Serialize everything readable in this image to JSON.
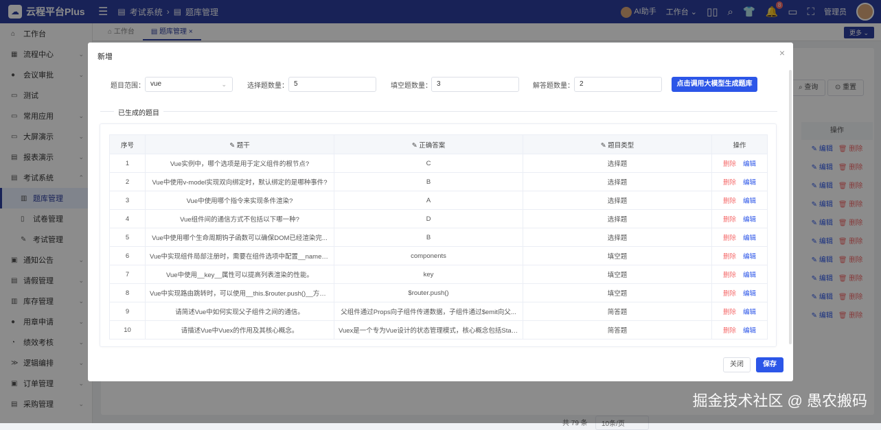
{
  "header": {
    "brand": "云程平台Plus",
    "breadcrumb": [
      "考试系统",
      "题库管理"
    ],
    "ai_label": "AI助手",
    "workbench_label": "工作台",
    "notification_count": "8",
    "user": "管理员"
  },
  "sidebar": {
    "items": [
      {
        "label": "工作台",
        "icon": "home-icon",
        "arrow": false
      },
      {
        "label": "流程中心",
        "icon": "grid-icon",
        "arrow": true
      },
      {
        "label": "会议审批",
        "icon": "user-icon",
        "arrow": true
      },
      {
        "label": "测试",
        "icon": "chat-icon",
        "arrow": false
      },
      {
        "label": "常用应用",
        "icon": "monitor-icon",
        "arrow": true
      },
      {
        "label": "大屏演示",
        "icon": "screen-icon",
        "arrow": true
      },
      {
        "label": "报表演示",
        "icon": "chart-icon",
        "arrow": true
      },
      {
        "label": "考试系统",
        "icon": "doc-icon",
        "arrow": true,
        "expanded": true
      },
      {
        "label": "题库管理",
        "icon": "bank-icon",
        "sub": true,
        "active": true
      },
      {
        "label": "试卷管理",
        "icon": "paper-icon",
        "sub": true
      },
      {
        "label": "考试管理",
        "icon": "pen-icon",
        "sub": true
      },
      {
        "label": "通知公告",
        "icon": "notice-icon",
        "arrow": true
      },
      {
        "label": "请假管理",
        "icon": "leave-icon",
        "arrow": true
      },
      {
        "label": "库存管理",
        "icon": "stock-icon",
        "arrow": true
      },
      {
        "label": "用章申请",
        "icon": "stamp-icon",
        "arrow": true
      },
      {
        "label": "绩效考核",
        "icon": "kpi-icon",
        "arrow": true
      },
      {
        "label": "逻辑编排",
        "icon": "logic-icon",
        "arrow": true
      },
      {
        "label": "订单管理",
        "icon": "order-icon",
        "arrow": true
      },
      {
        "label": "采购管理",
        "icon": "cart-icon",
        "arrow": true
      }
    ]
  },
  "tabs": [
    {
      "label": "工作台"
    },
    {
      "label": "题库管理"
    }
  ],
  "more_label": "更多",
  "background": {
    "query_label": "查询",
    "reset_label": "重置",
    "op_header": "操作",
    "edit_label": "编辑",
    "delete_label": "删除",
    "total_text": "共 79 条",
    "page_size": "10条/页"
  },
  "watermark": "掘金技术社区 @ 愚农搬码",
  "modal": {
    "title": "新增",
    "form": {
      "scope_label": "题目范围：",
      "scope_value": "vue",
      "choice_label": "选择题数量：",
      "choice_value": "5",
      "fill_label": "填空题数量：",
      "fill_value": "3",
      "answer_label": "解答题数量：",
      "answer_value": "2",
      "generate_label": "点击调用大模型生成题库"
    },
    "section_label": "已生成的题目",
    "table": {
      "headers": {
        "no": "序号",
        "stem": "题干",
        "answer": "正确答案",
        "type": "题目类型",
        "op": "操作"
      },
      "rows": [
        {
          "no": "1",
          "stem": "Vue实例中，哪个选项是用于定义组件的根节点?",
          "answer": "C",
          "type": "选择题"
        },
        {
          "no": "2",
          "stem": "Vue中使用v-model实现双向绑定时，默认绑定的是哪种事件?",
          "answer": "B",
          "type": "选择题"
        },
        {
          "no": "3",
          "stem": "Vue中使用哪个指令来实现条件渲染?",
          "answer": "A",
          "type": "选择题"
        },
        {
          "no": "4",
          "stem": "Vue组件间的通信方式不包括以下哪一种?",
          "answer": "D",
          "type": "选择题"
        },
        {
          "no": "5",
          "stem": "Vue中使用哪个生命周期钩子函数可以确保DOM已经渲染完...",
          "answer": "B",
          "type": "选择题"
        },
        {
          "no": "6",
          "stem": "Vue中实现组件局部注册时，需要在组件选项中配置__name__...",
          "answer": "components",
          "type": "填空题"
        },
        {
          "no": "7",
          "stem": "Vue中使用__key__属性可以提高列表渲染的性能。",
          "answer": "key",
          "type": "填空题"
        },
        {
          "no": "8",
          "stem": "Vue中实现路由跳转时，可以使用__this.$router.push()__方法。",
          "answer": "$router.push()",
          "type": "填空题"
        },
        {
          "no": "9",
          "stem": "请简述Vue中如何实现父子组件之间的通信。",
          "answer": "父组件通过Props向子组件传递数据，子组件通过$emit向父...",
          "type": "简答题"
        },
        {
          "no": "10",
          "stem": "请描述Vue中Vuex的作用及其核心概念。",
          "answer": "Vuex是一个专为Vue设计的状态管理模式，核心概念包括Stat...",
          "type": "简答题"
        }
      ],
      "delete_label": "删除",
      "edit_label": "编辑"
    },
    "close_label": "关闭",
    "save_label": "保存"
  }
}
